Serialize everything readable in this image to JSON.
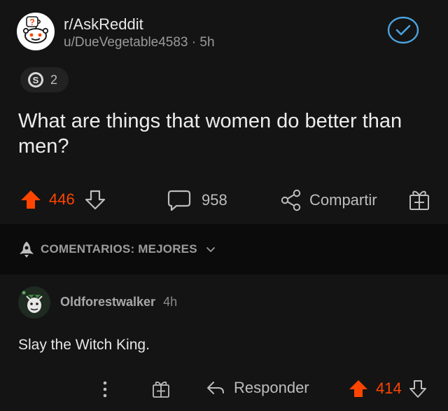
{
  "post": {
    "subreddit": "r/AskReddit",
    "author": "u/DueVegetable4583",
    "age": "5h",
    "award_count": "2",
    "title": "What are things that women do better than men?",
    "upvotes": "446",
    "comments": "958",
    "share_label": "Compartir"
  },
  "sort": {
    "label": "COMENTARIOS: MEJORES"
  },
  "comment": {
    "username": "Oldforestwalker",
    "age": "4h",
    "body": "Slay the Witch King.",
    "reply_label": "Responder",
    "upvotes": "414"
  },
  "colors": {
    "upvote_active": "#ff4500",
    "background": "#0b0b0b",
    "card": "#141414",
    "check_accent": "#4aa3df"
  },
  "icons": {
    "subreddit_avatar": "askreddit-snoo-icon",
    "check": "check-circle-icon",
    "award": "award-icon",
    "upvote": "upvote-arrow-icon",
    "downvote": "downvote-arrow-icon",
    "comment": "comment-bubble-icon",
    "share": "share-icon",
    "gift": "gift-icon",
    "sort": "rocket-icon",
    "chevron": "chevron-down-icon",
    "more": "more-vertical-icon",
    "reply": "reply-arrow-icon"
  }
}
